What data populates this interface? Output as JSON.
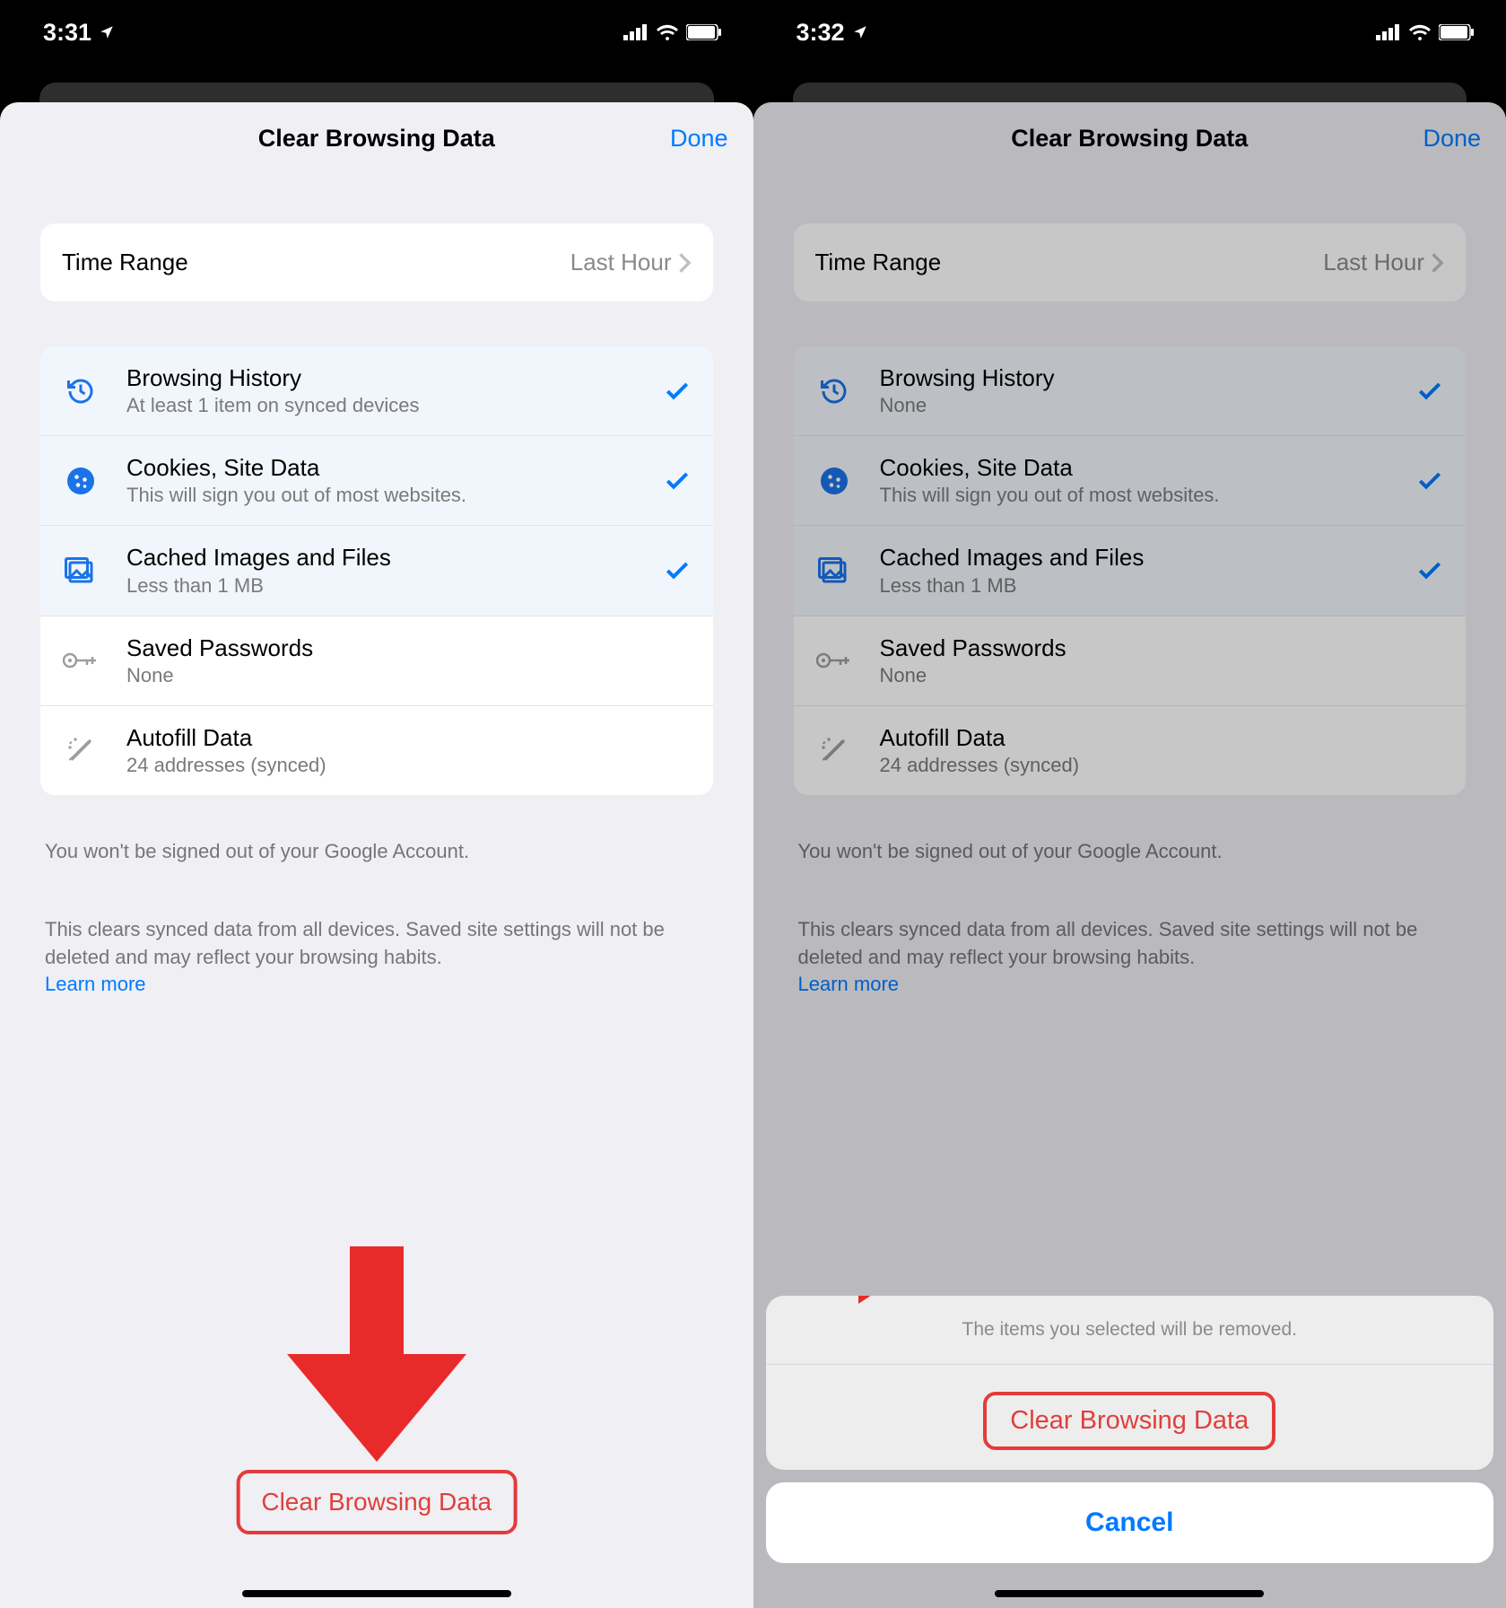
{
  "left": {
    "status_time": "3:31",
    "nav_title": "Clear Browsing Data",
    "nav_done": "Done",
    "time_range_label": "Time Range",
    "time_range_value": "Last Hour",
    "items": [
      {
        "title": "Browsing History",
        "sub": "At least 1 item on synced devices",
        "selected": true,
        "icon": "history"
      },
      {
        "title": "Cookies, Site Data",
        "sub": "This will sign you out of most websites.",
        "selected": true,
        "icon": "cookie"
      },
      {
        "title": "Cached Images and Files",
        "sub": "Less than 1 MB",
        "selected": true,
        "icon": "image"
      },
      {
        "title": "Saved Passwords",
        "sub": "None",
        "selected": false,
        "icon": "key"
      },
      {
        "title": "Autofill Data",
        "sub": "24 addresses (synced)",
        "selected": false,
        "icon": "wand"
      }
    ],
    "footer1": "You won't be signed out of your Google Account.",
    "footer2": "This clears synced data from all devices. Saved site settings will not be deleted and may reflect your browsing habits.",
    "learn_more": "Learn more",
    "clear_button": "Clear Browsing Data"
  },
  "right": {
    "status_time": "3:32",
    "nav_title": "Clear Browsing Data",
    "nav_done": "Done",
    "time_range_label": "Time Range",
    "time_range_value": "Last Hour",
    "items": [
      {
        "title": "Browsing History",
        "sub": "None",
        "selected": true,
        "icon": "history"
      },
      {
        "title": "Cookies, Site Data",
        "sub": "This will sign you out of most websites.",
        "selected": true,
        "icon": "cookie"
      },
      {
        "title": "Cached Images and Files",
        "sub": "Less than 1 MB",
        "selected": true,
        "icon": "image"
      },
      {
        "title": "Saved Passwords",
        "sub": "None",
        "selected": false,
        "icon": "key"
      },
      {
        "title": "Autofill Data",
        "sub": "24 addresses (synced)",
        "selected": false,
        "icon": "wand"
      }
    ],
    "footer1": "You won't be signed out of your Google Account.",
    "footer2": "This clears synced data from all devices. Saved site settings will not be deleted and may reflect your browsing habits.",
    "learn_more": "Learn more",
    "action_header": "The items you selected will be removed.",
    "action_clear": "Clear Browsing Data",
    "action_cancel": "Cancel"
  }
}
